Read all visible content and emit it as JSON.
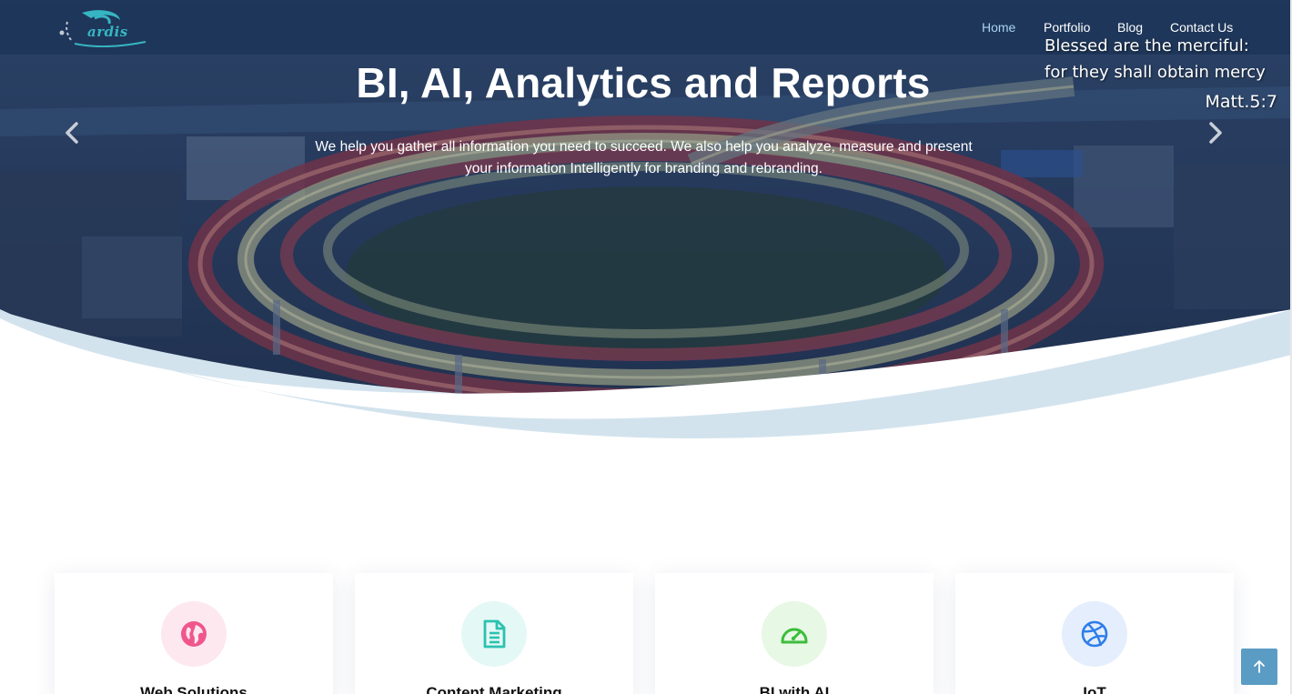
{
  "brand": {
    "logo_text": "ardis",
    "logo_color": "#36b6c2"
  },
  "nav": {
    "items": [
      {
        "label": "Home",
        "active": true
      },
      {
        "label": "Portfolio",
        "active": false
      },
      {
        "label": "Blog",
        "active": false
      },
      {
        "label": "Contact Us",
        "active": false
      }
    ]
  },
  "quote": {
    "line1": "Blessed are the merciful:",
    "line2": "for they shall obtain mercy",
    "reference": "Matt.5:7"
  },
  "hero": {
    "title": "BI, AI, Analytics and Reports",
    "subtitle_line1": "We help you gather all information you need to succeed. We also help you analyze, measure and present",
    "subtitle_line2": "your information Intelligently for branding and rebranding.",
    "prev_icon": "chevron-left-icon",
    "next_icon": "chevron-right-icon",
    "overlay_color": "#1e3a66",
    "wave_color": "#d3e3ee"
  },
  "services": [
    {
      "title": "Web Solutions",
      "icon": "globe-icon",
      "icon_color": "#f0568c",
      "icon_bg": "#fde8ef"
    },
    {
      "title": "Content Marketing",
      "icon": "document-icon",
      "icon_color": "#2bc2b0",
      "icon_bg": "#e4f8f6"
    },
    {
      "title": "BI with AI",
      "icon": "speedometer-icon",
      "icon_color": "#3cbd3c",
      "icon_bg": "#e7f8e4"
    },
    {
      "title": "IoT",
      "icon": "dribbble-icon",
      "icon_color": "#2e7de8",
      "icon_bg": "#e4eefc"
    }
  ],
  "back_to_top": {
    "icon": "arrow-up-icon",
    "color": "#5b9cc4"
  }
}
